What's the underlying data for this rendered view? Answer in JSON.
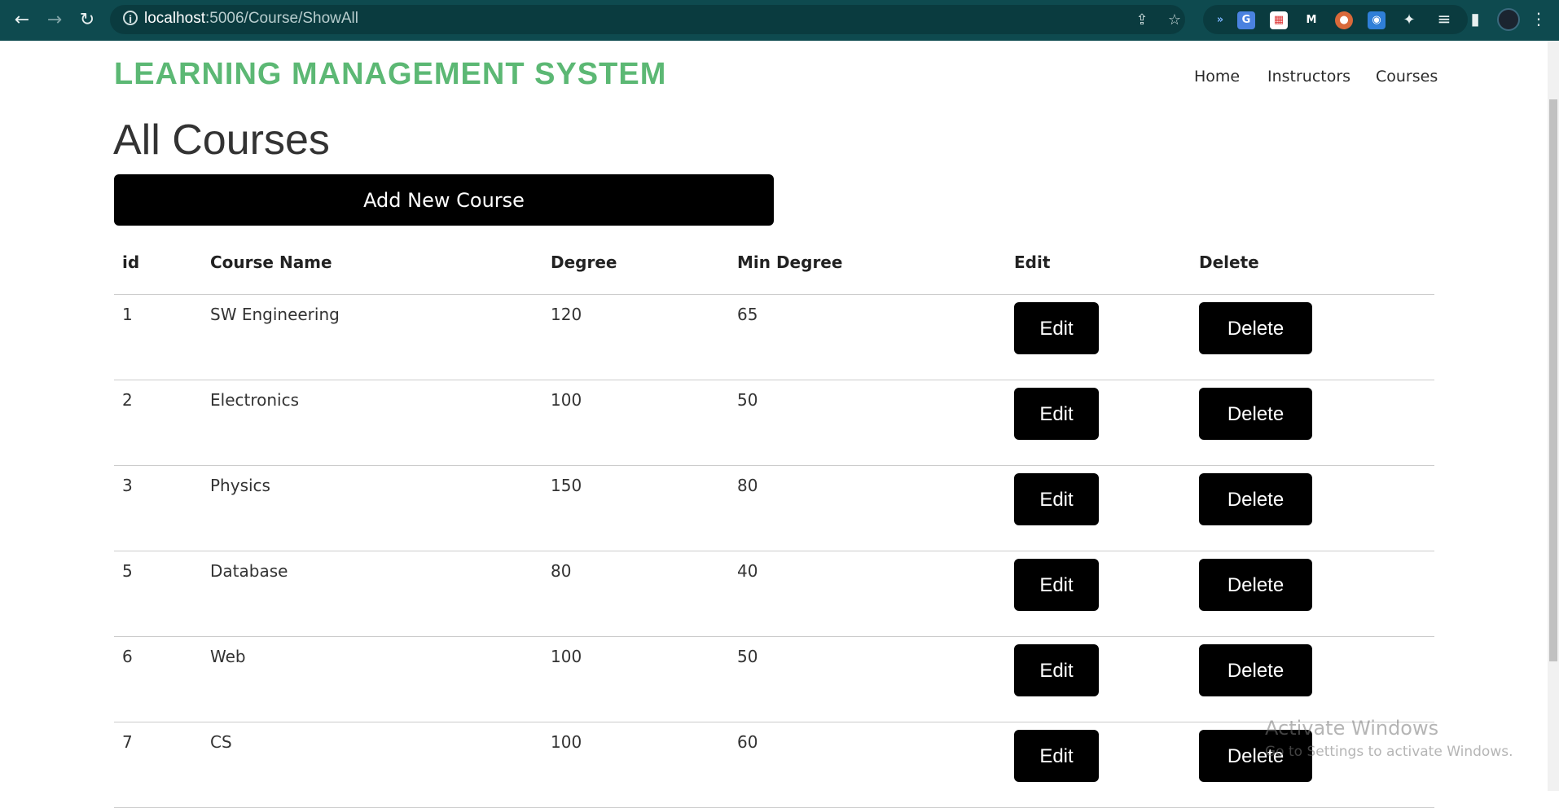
{
  "browser": {
    "url_host": "localhost",
    "url_path": ":5006/Course/ShowAll",
    "back_icon": "←",
    "forward_icon": "→",
    "reload_icon": "↻"
  },
  "brand": "LEARNING MANAGEMENT SYSTEM",
  "nav": {
    "home": "Home",
    "instructors": "Instructors",
    "courses": "Courses"
  },
  "page_title": "All Courses",
  "add_button": "Add New Course",
  "table": {
    "headers": [
      "id",
      "Course Name",
      "Degree",
      "Min Degree",
      "Edit",
      "Delete"
    ],
    "rows": [
      {
        "id": "1",
        "name": "SW Engineering",
        "degree": "120",
        "min": "65"
      },
      {
        "id": "2",
        "name": "Electronics",
        "degree": "100",
        "min": "50"
      },
      {
        "id": "3",
        "name": "Physics",
        "degree": "150",
        "min": "80"
      },
      {
        "id": "5",
        "name": "Database",
        "degree": "80",
        "min": "40"
      },
      {
        "id": "6",
        "name": "Web",
        "degree": "100",
        "min": "50"
      },
      {
        "id": "7",
        "name": "CS",
        "degree": "100",
        "min": "60"
      }
    ],
    "edit_label": "Edit",
    "delete_label": "Delete"
  },
  "watermark": {
    "line1": "Activate Windows",
    "line2": "Go to Settings to activate Windows."
  },
  "colors": {
    "brand": "#5cb874",
    "chrome": "#0e4a4f",
    "button": "#000000"
  }
}
